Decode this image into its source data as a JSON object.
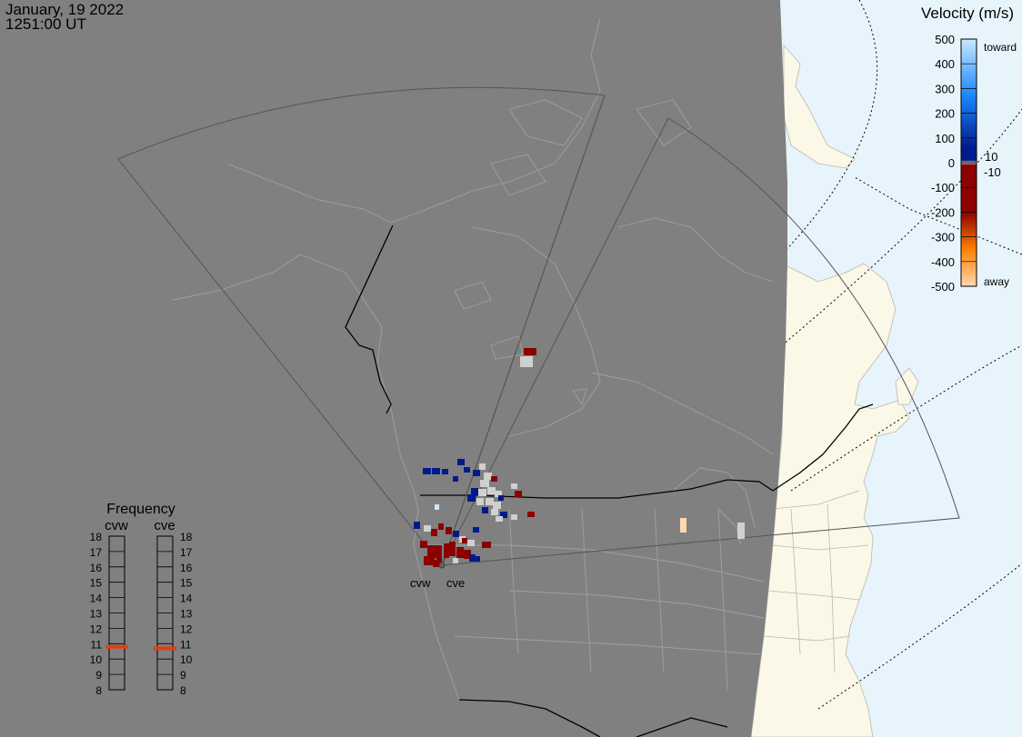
{
  "header": {
    "date": "January, 19 2022",
    "time": "1251:00 UT"
  },
  "map": {
    "night_color": "#808080",
    "ocean_color": "#e8f4fc",
    "land_color": "#fbf8e8",
    "radars": [
      {
        "code": "cvw"
      },
      {
        "code": "cve"
      }
    ]
  },
  "velocity_legend": {
    "title": "Velocity (m/s)",
    "toward_label": "toward",
    "away_label": "away",
    "ticks": [
      "500",
      "400",
      "300",
      "200",
      "100",
      "0",
      "-100",
      "-200",
      "-300",
      "-400",
      "-500"
    ],
    "near_zero_pos": "10",
    "near_zero_neg": "-10",
    "colors": {
      "toward_high": "#c8e8ff",
      "toward_mid": "#1e8cff",
      "toward_low": "#001a8c",
      "zero": "#d0d0d0",
      "away_low": "#8c0000",
      "away_mid": "#ff8000",
      "away_high": "#ffd8b0"
    }
  },
  "frequency_panel": {
    "title": "Frequency",
    "left_label": "cvw",
    "right_label": "cve",
    "mhz_ticks": [
      "18",
      "17",
      "16",
      "15",
      "14",
      "13",
      "12",
      "11",
      "10",
      "9",
      "8"
    ],
    "cvw_mhz": 10.8,
    "cve_mhz": 10.7,
    "marker_color": "#e04010"
  }
}
